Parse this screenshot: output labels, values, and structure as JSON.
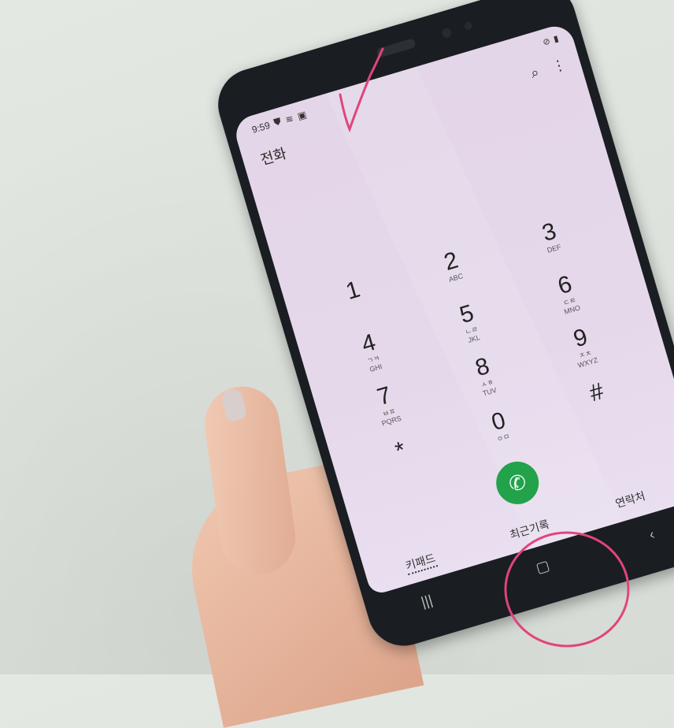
{
  "status_bar": {
    "time": "9:59",
    "icons": [
      "shield-icon",
      "wifi-icon",
      "gallery-icon"
    ],
    "right_icons": [
      "dnd-icon",
      "lock-icon"
    ]
  },
  "app": {
    "title": "전화"
  },
  "toolbar": {
    "search_icon": "search-icon",
    "menu_icon": "more-vertical-icon"
  },
  "keypad": [
    {
      "digit": "1",
      "letters": ""
    },
    {
      "digit": "2",
      "letters": "ABC"
    },
    {
      "digit": "3",
      "letters": "DEF"
    },
    {
      "digit": "4",
      "letters": "GHI"
    },
    {
      "digit": "5",
      "letters": "JKL"
    },
    {
      "digit": "6",
      "letters": "MNO"
    },
    {
      "digit": "7",
      "letters": "PQRS"
    },
    {
      "digit": "8",
      "letters": "TUV"
    },
    {
      "digit": "9",
      "letters": "WXYZ"
    },
    {
      "digit": "*",
      "letters": ""
    },
    {
      "digit": "0",
      "letters": "ㅇㅁ"
    },
    {
      "digit": "#",
      "letters": ""
    }
  ],
  "keypad_korean": {
    "4": "ㄱㅋ",
    "5": "ㄴㄹ",
    "6": "ㄷㅌ",
    "7": "ㅂㅍ",
    "8": "ㅅㅎ",
    "9": "ㅈㅊ"
  },
  "call_button": {
    "icon": "phone-icon"
  },
  "tabs": [
    {
      "label": "키패드",
      "active": true
    },
    {
      "label": "최근기록",
      "active": false
    },
    {
      "label": "연락처",
      "active": false
    }
  ],
  "nav": {
    "recent": "recents-icon",
    "home": "home-icon",
    "back": "back-icon"
  },
  "annotations": {
    "pen_color": "#e0457b"
  }
}
